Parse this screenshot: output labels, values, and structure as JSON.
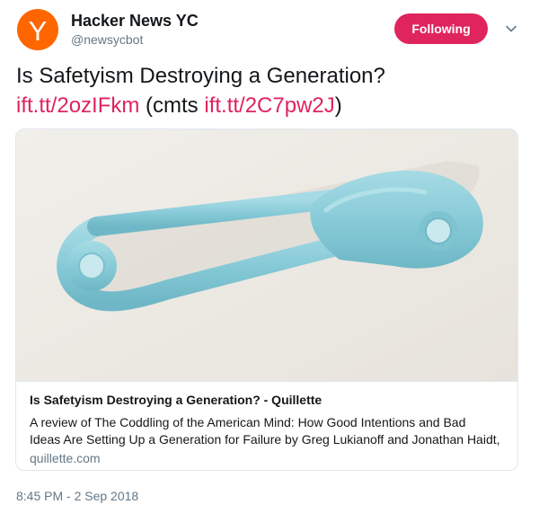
{
  "author": {
    "avatar_letter": "Y",
    "display_name": "Hacker News YC",
    "handle": "@newsycbot"
  },
  "follow_button": {
    "label": "Following"
  },
  "menu_icon": "chevron-down-icon",
  "tweet": {
    "title_text": "Is Safetyism Destroying a Generation?",
    "link1": "ift.tt/2ozIFkm",
    "cmts_prefix": " (cmts ",
    "link2": "ift.tt/2C7pw2J",
    "close_paren": ")"
  },
  "card": {
    "image_alt": "light blue safety pin",
    "title": "Is Safetyism Destroying a Generation? - Quillette",
    "description_line1": "A review of The Coddling of the American Mind: How Good Intentions and Bad",
    "description_line2": "Ideas Are Setting Up a Generation for Failure by Greg Lukianoff and Jonathan Haidt,",
    "domain": "quillette.com"
  },
  "timestamp": "8:45 PM - 2 Sep 2018",
  "colors": {
    "avatar_bg": "#ff6600",
    "accent": "#e0245e",
    "secondary_text": "#657786",
    "pin_color": "#8ccfdb"
  }
}
